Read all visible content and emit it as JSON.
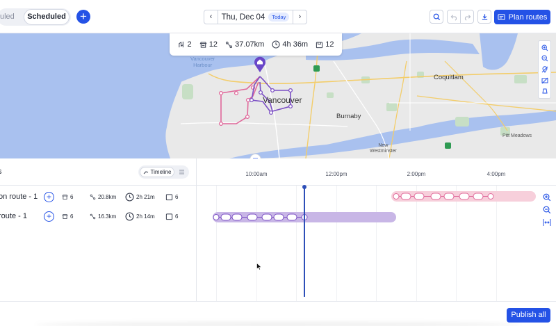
{
  "toolbar": {
    "segment_unscheduled": "uled",
    "segment_scheduled": "Scheduled",
    "add_label": "+",
    "prev_label": "‹",
    "next_label": "›",
    "date": "Thu, Dec 04",
    "today_badge": "Today",
    "plan_routes": "Plan routes",
    "icons": [
      "search-icon",
      "undo-icon",
      "redo-icon",
      "download-icon",
      "route-icon"
    ]
  },
  "stats": {
    "routes": "2",
    "stops": "12",
    "distance": "37.07km",
    "duration": "4h 36m",
    "orders": "12"
  },
  "map": {
    "labels": {
      "vancouver_harbour": "Vancouver\nHarbour",
      "vancouver": "Vancouver",
      "burnaby": "Burnaby",
      "coquitlam": "Coquitlam",
      "new_westminster": "New\nWestminster",
      "pitt_meadows": "Pitt Meadows"
    },
    "colors": {
      "purple_route": "#7b4fc4",
      "pink_route": "#e0689a",
      "pin": "#6a47c8"
    }
  },
  "timeline": {
    "title": "s",
    "view_toggle_label": "Timeline",
    "hours": [
      "10:00am",
      "12:00pm",
      "2:00pm",
      "4:00pm"
    ],
    "routes": [
      {
        "name": "on route - 1",
        "stops": "6",
        "distance": "20.8km",
        "duration": "2h 21m",
        "orders": "6",
        "color": "#f7cfdb",
        "stop_count": 6
      },
      {
        "name": "route - 1",
        "stops": "6",
        "distance": "16.3km",
        "duration": "2h 14m",
        "orders": "6",
        "color": "#c8b6e6",
        "stop_count": 6
      }
    ]
  },
  "footer": {
    "publish": "Publish all"
  }
}
